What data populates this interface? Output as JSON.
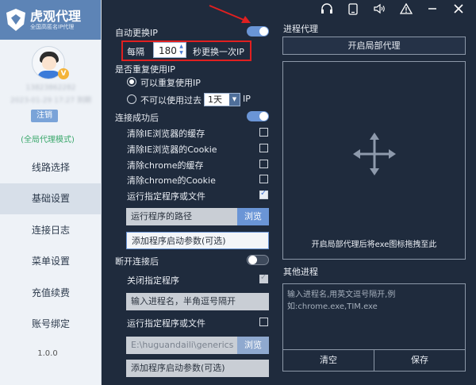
{
  "sidebar": {
    "brand": "虎观代理",
    "brand_sub": "全国高匿名IP代理",
    "vip_badge": "V",
    "blur_line1": "13823862282",
    "blur_line2": "2023-01-29 17:27 到期",
    "logout_label": "注销",
    "mode_label": "(全局代理模式)",
    "nav": [
      {
        "label": "线路选择"
      },
      {
        "label": "基础设置"
      },
      {
        "label": "连接日志"
      },
      {
        "label": "菜单设置"
      },
      {
        "label": "充值续费"
      },
      {
        "label": "账号绑定"
      }
    ],
    "version": "1.0.0"
  },
  "settings": {
    "auto_switch_label": "自动更换IP",
    "interval_prefix": "每隔",
    "interval_value": "180",
    "interval_suffix": "秒更换一次IP",
    "reuse_label": "是否重复使用IP",
    "reuse_yes": "可以重复使用IP",
    "reuse_no": "不可以使用过去",
    "reuse_period": "1天",
    "reuse_period_suffix": "IP",
    "after_connect_label": "连接成功后",
    "clear_ie_cache": "清除IE浏览器的缓存",
    "clear_ie_cookie": "清除IE浏览器的Cookie",
    "clear_chrome_cache": "清除chrome的缓存",
    "clear_chrome_cookie": "清除chrome的Cookie",
    "run_program": "运行指定程序或文件",
    "program_path_placeholder": "运行程序的路径",
    "browse_label": "浏览",
    "program_args_placeholder": "添加程序启动参数(可选)",
    "after_disconnect_label": "断开连接后",
    "close_program": "关闭指定程序",
    "process_name_placeholder": "输入进程名，半角逗号隔开",
    "run_program2": "运行指定程序或文件",
    "program_path2_value": "E:\\huguandaili\\generics",
    "browse2_label": "浏览",
    "program_args2_placeholder": "添加程序启动参数(可选)"
  },
  "proxy": {
    "title": "进程代理",
    "enable_button": "开启局部代理",
    "drop_hint": "开启局部代理后将exe图标拖拽至此",
    "other_title": "其他进程",
    "other_placeholder": "输入进程名,用英文逗号隔开,例如:chrome.exe,TIM.exe",
    "clear_button": "清空",
    "save_button": "保存"
  },
  "colors": {
    "accent": "#6a95d6",
    "highlight_box": "#e02020",
    "background": "#1f2b3d"
  }
}
